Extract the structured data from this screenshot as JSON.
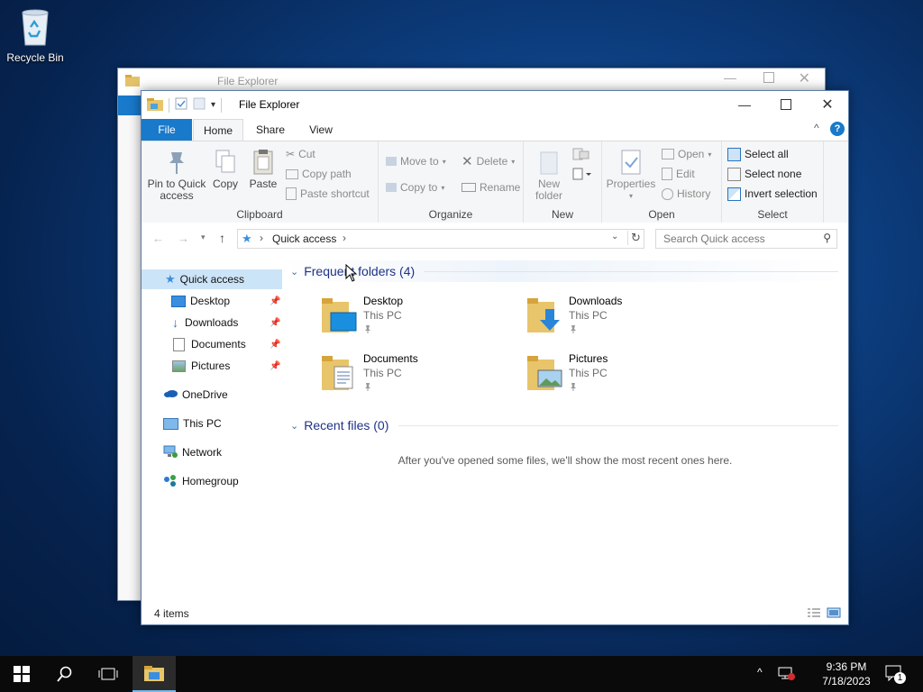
{
  "desktop": {
    "recycle_bin_label": "Recycle Bin"
  },
  "back_window": {
    "title": "File Explorer"
  },
  "window": {
    "title": "File Explorer",
    "tabs": {
      "file": "File",
      "home": "Home",
      "share": "Share",
      "view": "View"
    },
    "ribbon": {
      "clipboard": {
        "name": "Clipboard",
        "pin_line1": "Pin to Quick",
        "pin_line2": "access",
        "copy": "Copy",
        "paste": "Paste",
        "cut": "Cut",
        "copy_path": "Copy path",
        "paste_shortcut": "Paste shortcut"
      },
      "organize": {
        "name": "Organize",
        "move_to": "Move to",
        "copy_to": "Copy to",
        "delete": "Delete",
        "rename": "Rename"
      },
      "new": {
        "name": "New",
        "new_line1": "New",
        "new_line2": "folder"
      },
      "open": {
        "name": "Open",
        "properties": "Properties",
        "open": "Open",
        "edit": "Edit",
        "history": "History"
      },
      "select": {
        "name": "Select",
        "select_all": "Select all",
        "select_none": "Select none",
        "invert": "Invert selection"
      }
    },
    "address": {
      "path": "Quick access",
      "search_placeholder": "Search Quick access"
    },
    "nav": {
      "quick_access": "Quick access",
      "desktop": "Desktop",
      "downloads": "Downloads",
      "documents": "Documents",
      "pictures": "Pictures",
      "onedrive": "OneDrive",
      "this_pc": "This PC",
      "network": "Network",
      "homegroup": "Homegroup"
    },
    "content": {
      "frequent_header": "Frequent folders (4)",
      "recent_header": "Recent files (0)",
      "empty_message": "After you've opened some files, we'll show the most recent ones here.",
      "folders": [
        {
          "name": "Desktop",
          "location": "This PC"
        },
        {
          "name": "Downloads",
          "location": "This PC"
        },
        {
          "name": "Documents",
          "location": "This PC"
        },
        {
          "name": "Pictures",
          "location": "This PC"
        }
      ]
    },
    "status": {
      "item_count": "4 items"
    }
  },
  "taskbar": {
    "time": "9:36 PM",
    "date": "7/18/2023",
    "notification_count": "1"
  }
}
